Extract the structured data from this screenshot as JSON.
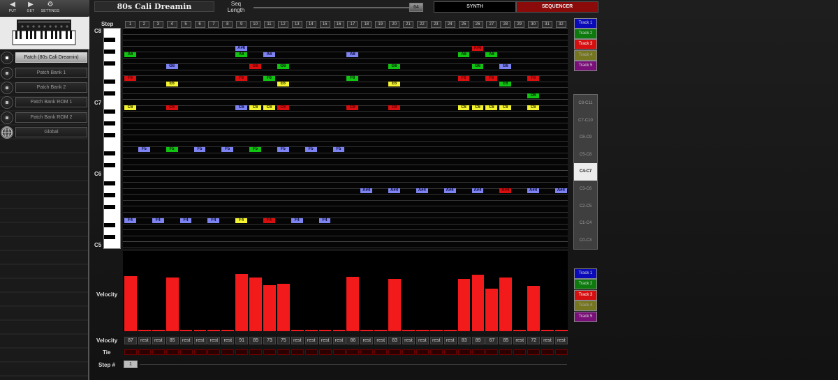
{
  "toolbar": {
    "put": {
      "label": "PUT",
      "icon": "arrow-left-icon"
    },
    "get": {
      "label": "GET",
      "icon": "arrow-right-icon"
    },
    "settings": {
      "label": "SETTINGS",
      "icon": "gear-icon"
    }
  },
  "sidebar": {
    "items": [
      {
        "label": "Patch (80s Cali Dreamin)",
        "active": true
      },
      {
        "label": "Patch Bank 1",
        "active": false
      },
      {
        "label": "Patch Bank 2",
        "active": false
      },
      {
        "label": "Patch Bank ROM 1",
        "active": false
      },
      {
        "label": "Patch Bank ROM 2",
        "active": false
      },
      {
        "label": "Global",
        "active": false,
        "icon": "globe-icon"
      }
    ]
  },
  "header": {
    "patch_name": "80s Cali Dreamin",
    "seq_length_label": "Seq Length",
    "seq_length_value": "64",
    "tabs": [
      {
        "label": "SYNTH",
        "active": false
      },
      {
        "label": "SEQUENCER",
        "active": true
      }
    ]
  },
  "grid": {
    "step_label": "Step",
    "steps": [
      "1",
      "2",
      "3",
      "4",
      "5",
      "6",
      "7",
      "8",
      "9",
      "10",
      "11",
      "12",
      "13",
      "14",
      "15",
      "16",
      "17",
      "18",
      "19",
      "20",
      "21",
      "22",
      "23",
      "24",
      "25",
      "26",
      "27",
      "28",
      "29",
      "30",
      "31",
      "32"
    ],
    "octave_labels": [
      "C8",
      "C7",
      "C6",
      "C5"
    ],
    "notes": [
      {
        "label": "A#6",
        "step": 9,
        "row": 3,
        "color": "blue"
      },
      {
        "label": "A#6",
        "step": 26,
        "row": 3,
        "color": "red"
      },
      {
        "label": "A6",
        "step": 1,
        "row": 4,
        "color": "green"
      },
      {
        "label": "A6",
        "step": 9,
        "row": 4,
        "color": "green"
      },
      {
        "label": "A6",
        "step": 11,
        "row": 4,
        "color": "blue"
      },
      {
        "label": "A6",
        "step": 17,
        "row": 4,
        "color": "blue"
      },
      {
        "label": "A6",
        "step": 25,
        "row": 4,
        "color": "green"
      },
      {
        "label": "A6",
        "step": 27,
        "row": 4,
        "color": "green"
      },
      {
        "label": "G6",
        "step": 4,
        "row": 6,
        "color": "blue"
      },
      {
        "label": "G6",
        "step": 10,
        "row": 6,
        "color": "red"
      },
      {
        "label": "G6",
        "step": 12,
        "row": 6,
        "color": "green"
      },
      {
        "label": "G6",
        "step": 20,
        "row": 6,
        "color": "green"
      },
      {
        "label": "G6",
        "step": 26,
        "row": 6,
        "color": "green"
      },
      {
        "label": "G6",
        "step": 28,
        "row": 6,
        "color": "blue"
      },
      {
        "label": "F6",
        "step": 1,
        "row": 8,
        "color": "red"
      },
      {
        "label": "F6",
        "step": 9,
        "row": 8,
        "color": "red"
      },
      {
        "label": "F6",
        "step": 11,
        "row": 8,
        "color": "green"
      },
      {
        "label": "F6",
        "step": 17,
        "row": 8,
        "color": "green"
      },
      {
        "label": "F6",
        "step": 25,
        "row": 8,
        "color": "red"
      },
      {
        "label": "F6",
        "step": 27,
        "row": 8,
        "color": "red"
      },
      {
        "label": "F6",
        "step": 30,
        "row": 8,
        "color": "red"
      },
      {
        "label": "E6",
        "step": 4,
        "row": 9,
        "color": "yellow"
      },
      {
        "label": "E6",
        "step": 12,
        "row": 9,
        "color": "yellow"
      },
      {
        "label": "E6",
        "step": 20,
        "row": 9,
        "color": "yellow"
      },
      {
        "label": "E6",
        "step": 28,
        "row": 9,
        "color": "green"
      },
      {
        "label": "D6",
        "step": 30,
        "row": 11,
        "color": "green"
      },
      {
        "label": "C6",
        "step": 1,
        "row": 13,
        "color": "yellow"
      },
      {
        "label": "C6",
        "step": 4,
        "row": 13,
        "color": "red"
      },
      {
        "label": "C6",
        "step": 9,
        "row": 13,
        "color": "blue"
      },
      {
        "label": "C6",
        "step": 10,
        "row": 13,
        "color": "yellow"
      },
      {
        "label": "C6",
        "step": 11,
        "row": 13,
        "color": "yellow"
      },
      {
        "label": "C6",
        "step": 12,
        "row": 13,
        "color": "red"
      },
      {
        "label": "C6",
        "step": 17,
        "row": 13,
        "color": "red"
      },
      {
        "label": "C6",
        "step": 20,
        "row": 13,
        "color": "red"
      },
      {
        "label": "C6",
        "step": 25,
        "row": 13,
        "color": "yellow"
      },
      {
        "label": "C6",
        "step": 26,
        "row": 13,
        "color": "yellow"
      },
      {
        "label": "C6",
        "step": 27,
        "row": 13,
        "color": "yellow"
      },
      {
        "label": "C6",
        "step": 28,
        "row": 13,
        "color": "yellow"
      },
      {
        "label": "C6",
        "step": 30,
        "row": 13,
        "color": "yellow"
      },
      {
        "label": "F5",
        "step": 2,
        "row": 20,
        "color": "blue"
      },
      {
        "label": "F5",
        "step": 4,
        "row": 20,
        "color": "green"
      },
      {
        "label": "F5",
        "step": 6,
        "row": 20,
        "color": "blue"
      },
      {
        "label": "F5",
        "step": 8,
        "row": 20,
        "color": "blue"
      },
      {
        "label": "F5",
        "step": 10,
        "row": 20,
        "color": "green"
      },
      {
        "label": "F5",
        "step": 12,
        "row": 20,
        "color": "blue"
      },
      {
        "label": "F5",
        "step": 14,
        "row": 20,
        "color": "blue"
      },
      {
        "label": "F5",
        "step": 16,
        "row": 20,
        "color": "blue"
      },
      {
        "label": "A#4",
        "step": 18,
        "row": 27,
        "color": "blue"
      },
      {
        "label": "A#4",
        "step": 20,
        "row": 27,
        "color": "blue"
      },
      {
        "label": "A#4",
        "step": 22,
        "row": 27,
        "color": "blue"
      },
      {
        "label": "A#4",
        "step": 24,
        "row": 27,
        "color": "blue"
      },
      {
        "label": "A#4",
        "step": 26,
        "row": 27,
        "color": "blue"
      },
      {
        "label": "A#4",
        "step": 28,
        "row": 27,
        "color": "red"
      },
      {
        "label": "A#4",
        "step": 30,
        "row": 27,
        "color": "blue"
      },
      {
        "label": "A#4",
        "step": 32,
        "row": 27,
        "color": "blue"
      },
      {
        "label": "F4",
        "step": 1,
        "row": 32,
        "color": "blue"
      },
      {
        "label": "F4",
        "step": 3,
        "row": 32,
        "color": "blue"
      },
      {
        "label": "F4",
        "step": 5,
        "row": 32,
        "color": "blue"
      },
      {
        "label": "F4",
        "step": 7,
        "row": 32,
        "color": "blue"
      },
      {
        "label": "F4",
        "step": 9,
        "row": 32,
        "color": "yellow"
      },
      {
        "label": "F4",
        "step": 11,
        "row": 32,
        "color": "red"
      },
      {
        "label": "F4",
        "step": 13,
        "row": 32,
        "color": "blue"
      },
      {
        "label": "F4",
        "step": 15,
        "row": 32,
        "color": "blue"
      }
    ]
  },
  "tracks": [
    "Track 1",
    "Track 2",
    "Track 3",
    "Track 4",
    "Track 5"
  ],
  "ranges": {
    "items": [
      "C8-C11",
      "C7-C10",
      "C6-C9",
      "C5-C8",
      "C4-C7",
      "C3-C6",
      "C2-C5",
      "C1-C4",
      "C0-C3"
    ],
    "active": "C4-C7"
  },
  "velocity": {
    "label": "Velocity",
    "row_label": "Velocity",
    "max": 127,
    "values": [
      "87",
      "rest",
      "rest",
      "85",
      "rest",
      "rest",
      "rest",
      "rest",
      "91",
      "85",
      "73",
      "75",
      "rest",
      "rest",
      "rest",
      "rest",
      "86",
      "rest",
      "rest",
      "83",
      "rest",
      "rest",
      "rest",
      "rest",
      "83",
      "89",
      "67",
      "85",
      "rest",
      "72",
      "rest",
      "rest"
    ]
  },
  "tie": {
    "label": "Tie"
  },
  "step_number": {
    "label": "Step #",
    "value": "1"
  },
  "colors": {
    "blue": "#7d83f0",
    "green": "#11c411",
    "red": "#d90e0e",
    "yellow": "#f4f431",
    "accent": "#8b0b0b",
    "velocity_bar": "#f21a1a"
  }
}
